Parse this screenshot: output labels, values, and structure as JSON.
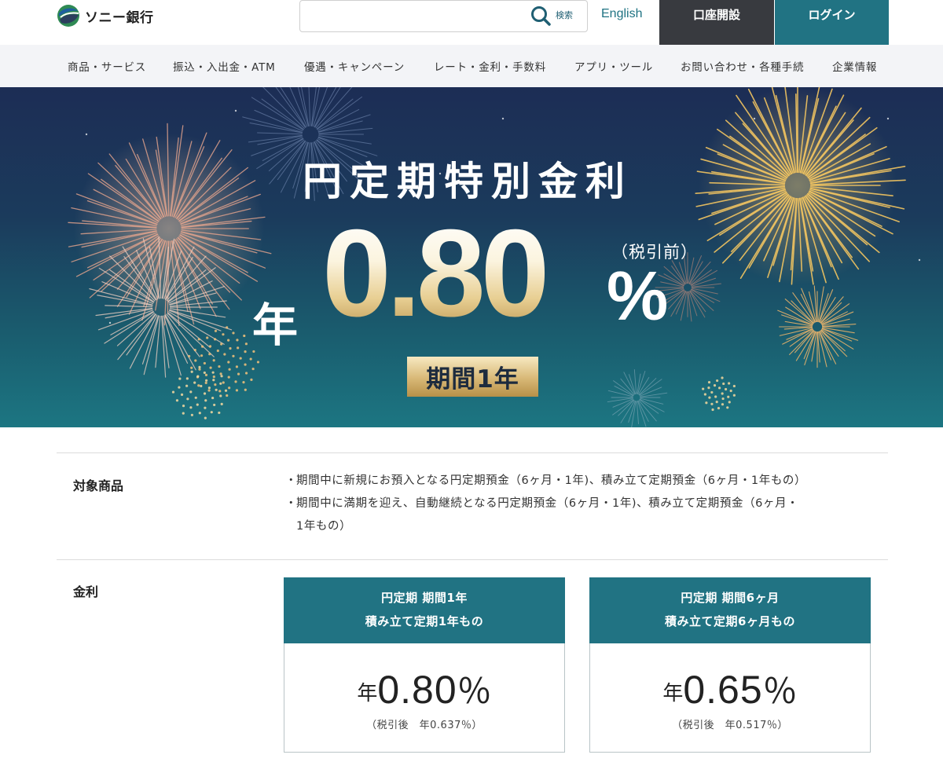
{
  "header": {
    "logo_text": "ソニー銀行",
    "search": {
      "value": "",
      "placeholder": "",
      "label": "検索"
    },
    "english_link": "English",
    "open_account_button": "口座開設",
    "login_button": "ログイン"
  },
  "nav": {
    "items": [
      {
        "label": "商品・サービス"
      },
      {
        "label": "振込・入出金・ATM"
      },
      {
        "label": "優遇・キャンペーン"
      },
      {
        "label": "レート・金利・手数料"
      },
      {
        "label": "アプリ・ツール"
      },
      {
        "label": "お問い合わせ・各種手続"
      },
      {
        "label": "企業情報"
      }
    ]
  },
  "hero": {
    "title": "円定期特別金利",
    "year_prefix": "年",
    "rate": "0.80",
    "percent": "%",
    "tax_note": "（税引前）",
    "period": "期間1年"
  },
  "info": {
    "target_label": "対象商品",
    "target_bullets": [
      "期間中に新規にお預入となる円定期預金（6ヶ月・1年)、積み立て定期預金（6ヶ月・1年もの）",
      "期間中に満期を迎え、自動継続となる円定期預金（6ヶ月・1年)、積み立て定期預金（6ヶ月・",
      "1年もの）"
    ],
    "rate_label": "金利",
    "cards": [
      {
        "title_line1": "円定期 期間1年",
        "title_line2": "積み立て定期1年もの",
        "prefix": "年",
        "rate": "0.80",
        "percent": "％",
        "after_tax": "（税引後　年0.637％）"
      },
      {
        "title_line1": "円定期 期間6ヶ月",
        "title_line2": "積み立て定期6ヶ月もの",
        "prefix": "年",
        "rate": "0.65",
        "percent": "％",
        "after_tax": "（税引後　年0.517％）"
      }
    ]
  },
  "colors": {
    "teal": "#217383",
    "dark_button": "#383a3f",
    "nav_bg": "#f3f4f7",
    "gold": "#d8b876"
  },
  "icons": [
    "logo-mark-icon",
    "search-icon"
  ]
}
